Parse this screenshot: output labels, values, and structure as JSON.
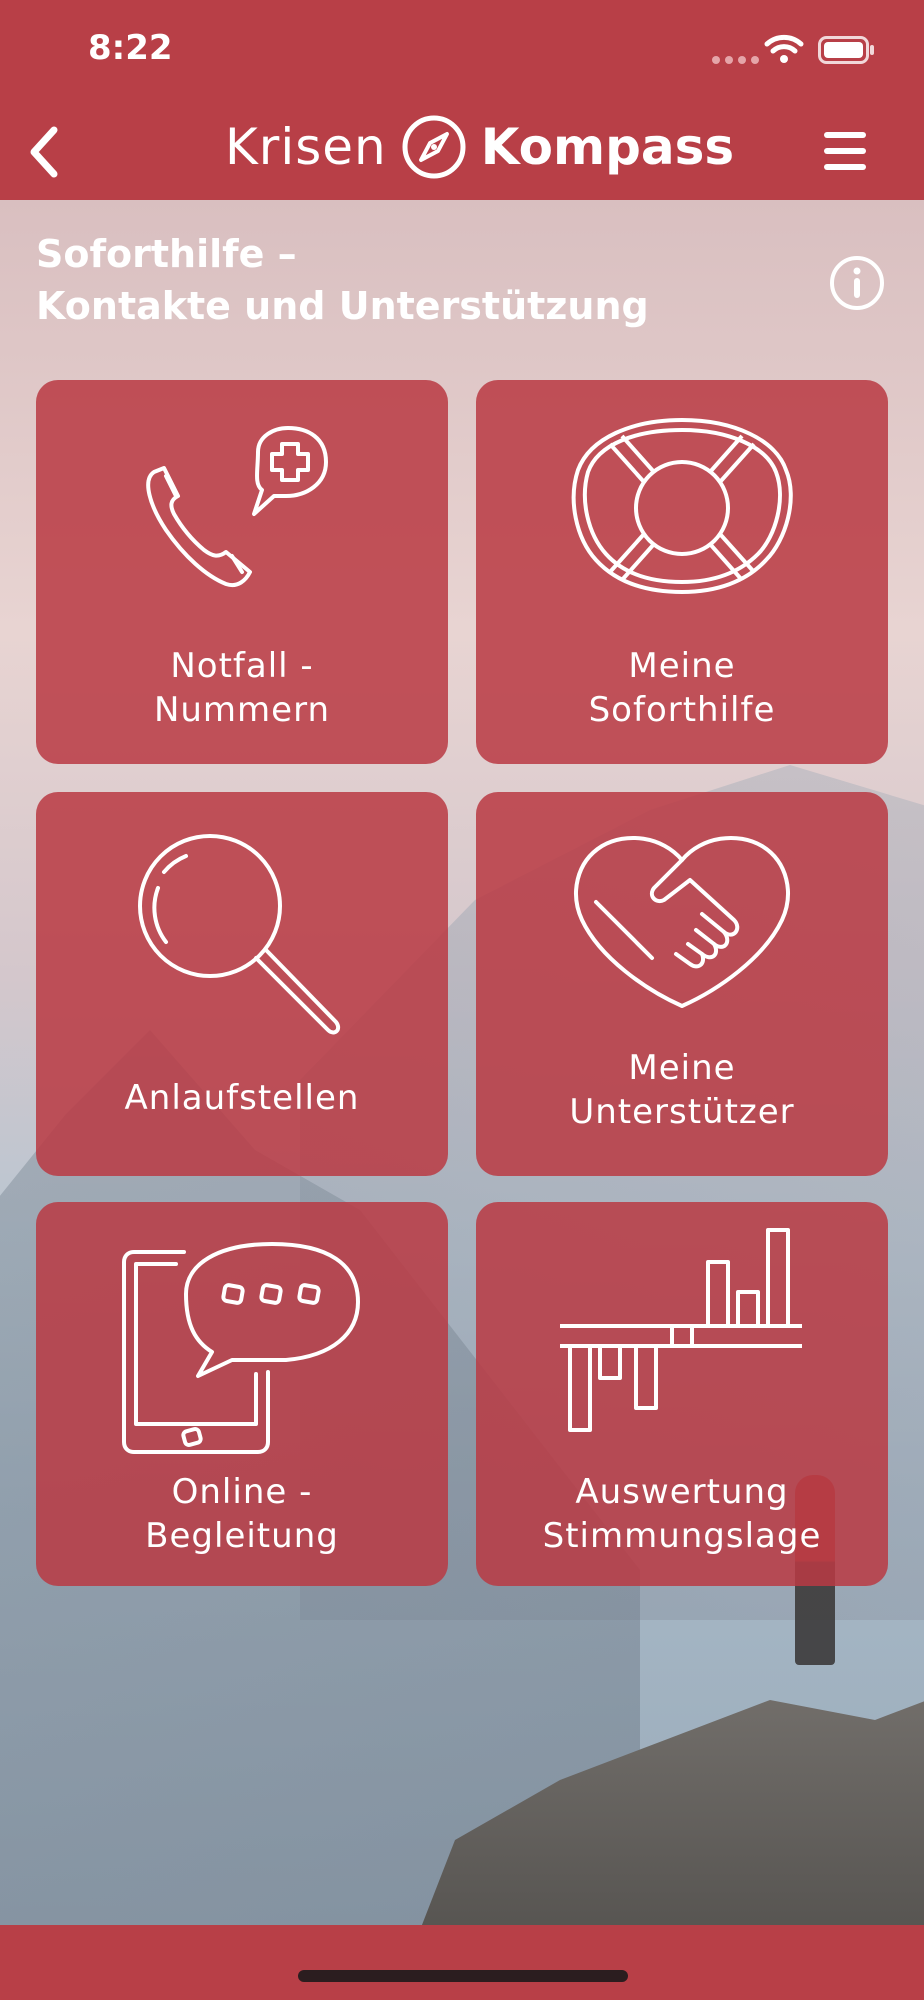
{
  "status_bar": {
    "time": "8:22"
  },
  "header": {
    "brand_light": "Krisen",
    "brand_bold": "Kompass"
  },
  "section": {
    "title_line1": "Soforthilfe –",
    "title_line2": "Kontakte und Unterstützung"
  },
  "tiles": [
    {
      "line1": "Notfall -",
      "line2": "Nummern",
      "icon": "phone-medical-icon"
    },
    {
      "line1": "Meine",
      "line2": "Soforthilfe",
      "icon": "lifebuoy-icon"
    },
    {
      "line1": "Anlaufstellen",
      "line2": "",
      "icon": "magnifier-icon"
    },
    {
      "line1": "Meine",
      "line2": "Unterstützer",
      "icon": "heart-handshake-icon"
    },
    {
      "line1": "Online -",
      "line2": "Begleitung",
      "icon": "tablet-chat-icon"
    },
    {
      "line1": "Auswertung",
      "line2": "Stimmungslage",
      "icon": "bar-chart-icon"
    }
  ],
  "colors": {
    "primary": "#b83f47",
    "tile": "#b93a44"
  }
}
